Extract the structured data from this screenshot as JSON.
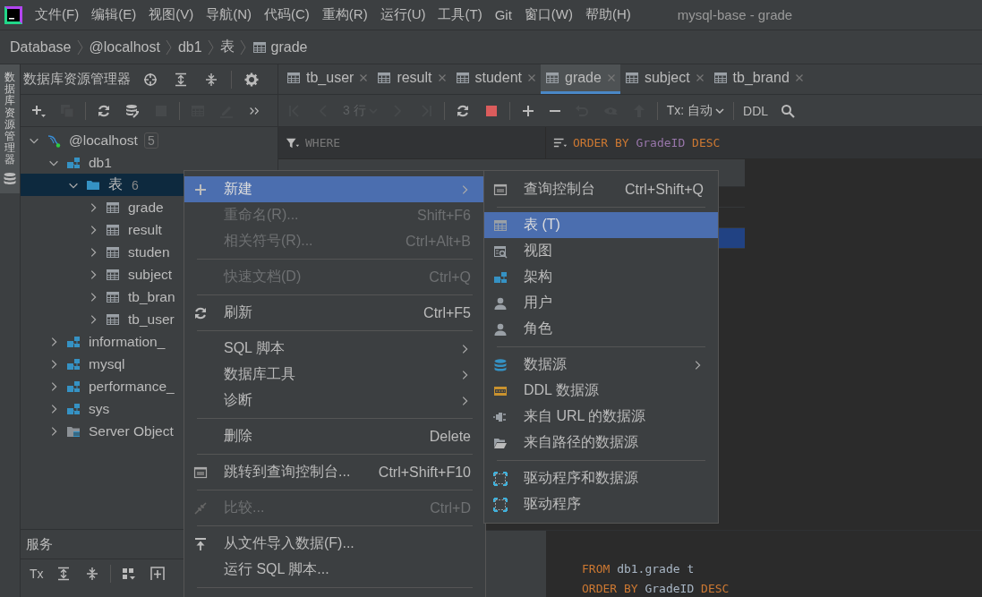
{
  "menu_bar": {
    "items": [
      "文件(F)",
      "编辑(E)",
      "视图(V)",
      "导航(N)",
      "代码(C)",
      "重构(R)",
      "运行(U)",
      "工具(T)",
      "Git",
      "窗口(W)",
      "帮助(H)"
    ],
    "title": "mysql-base - grade"
  },
  "breadcrumb": [
    {
      "label": "Database",
      "kind": "text"
    },
    {
      "label": "@localhost",
      "kind": "text"
    },
    {
      "label": "db1",
      "kind": "text"
    },
    {
      "label": "表",
      "kind": "text"
    },
    {
      "label": "grade",
      "kind": "table"
    }
  ],
  "side_stripe": {
    "label": "数据库资源管理器",
    "selected": true
  },
  "explorer": {
    "title": "数据库资源管理器",
    "toolbar": [
      {
        "kind": "add",
        "disabled": false
      },
      {
        "kind": "copy",
        "disabled": true
      },
      {
        "kind": "separator"
      },
      {
        "kind": "refresh",
        "disabled": false
      },
      {
        "kind": "db-settings",
        "disabled": false
      },
      {
        "kind": "stop",
        "disabled": true
      },
      {
        "kind": "separator"
      },
      {
        "kind": "table",
        "disabled": true
      },
      {
        "kind": "edit",
        "disabled": true
      },
      {
        "kind": "more",
        "disabled": false
      }
    ],
    "tree": [
      {
        "label": "@localhost",
        "count": "5",
        "kind": "host",
        "expanded": true,
        "selected": false,
        "children": [
          {
            "label": "db1",
            "kind": "schema",
            "expanded": true,
            "selected": false,
            "children": [
              {
                "label": "表",
                "count": "6",
                "kind": "folder",
                "expanded": true,
                "selected": true,
                "children": [
                  {
                    "label": "grade",
                    "kind": "table",
                    "expanded": false,
                    "selected": false
                  },
                  {
                    "label": "result",
                    "kind": "table",
                    "expanded": false,
                    "selected": false
                  },
                  {
                    "label": "studen",
                    "kind": "table",
                    "expanded": false,
                    "selected": false
                  },
                  {
                    "label": "subject",
                    "kind": "table",
                    "expanded": false,
                    "selected": false
                  },
                  {
                    "label": "tb_bran",
                    "kind": "table",
                    "expanded": false,
                    "selected": false
                  },
                  {
                    "label": "tb_user",
                    "kind": "table",
                    "expanded": false,
                    "selected": false
                  }
                ]
              }
            ]
          },
          {
            "label": "information_",
            "kind": "schema",
            "expanded": false,
            "selected": false
          },
          {
            "label": "mysql",
            "kind": "schema",
            "expanded": false,
            "selected": false
          },
          {
            "label": "performance_",
            "kind": "schema",
            "expanded": false,
            "selected": false
          },
          {
            "label": "sys",
            "kind": "schema",
            "expanded": false,
            "selected": false
          },
          {
            "label": "Server Object",
            "kind": "server",
            "expanded": false,
            "selected": false
          }
        ]
      }
    ]
  },
  "services": {
    "title": "服务",
    "toolbar": [
      {
        "kind": "tx",
        "label": "Tx"
      },
      {
        "kind": "expand"
      },
      {
        "kind": "collapse"
      },
      {
        "kind": "separator"
      },
      {
        "kind": "group"
      },
      {
        "kind": "add-frame"
      }
    ]
  },
  "editor_tabs": [
    {
      "label": "tb_user",
      "selected": false
    },
    {
      "label": "result",
      "selected": false
    },
    {
      "label": "student",
      "selected": false
    },
    {
      "label": "grade",
      "selected": true
    },
    {
      "label": "subject",
      "selected": false
    },
    {
      "label": "tb_brand",
      "selected": false
    }
  ],
  "editor_toolbar": [
    {
      "kind": "first",
      "disabled": true
    },
    {
      "kind": "previous",
      "disabled": true
    },
    {
      "kind": "rows",
      "label": "3 行",
      "disabled": true
    },
    {
      "kind": "next",
      "disabled": true
    },
    {
      "kind": "last",
      "disabled": true
    },
    {
      "kind": "separator"
    },
    {
      "kind": "refresh",
      "disabled": false
    },
    {
      "kind": "stop",
      "disabled": false
    },
    {
      "kind": "separator"
    },
    {
      "kind": "plus",
      "disabled": false
    },
    {
      "kind": "minus",
      "disabled": false
    },
    {
      "kind": "undo",
      "disabled": true
    },
    {
      "kind": "preview",
      "disabled": true
    },
    {
      "kind": "up",
      "disabled": true
    },
    {
      "kind": "separator"
    },
    {
      "kind": "tx",
      "label": "Tx: 自动",
      "disabled": false
    },
    {
      "kind": "separator"
    },
    {
      "kind": "ddl",
      "label": "DDL",
      "disabled": false
    },
    {
      "kind": "search",
      "disabled": false
    }
  ],
  "filter": {
    "where": {
      "placeholder": "WHERE"
    },
    "order": [
      {
        "text": "ORDER BY",
        "kind": "keyword"
      },
      {
        "text": "GradeID",
        "kind": "field"
      },
      {
        "text": "DESC",
        "kind": "keyword"
      }
    ]
  },
  "grid": {
    "rows": [
      {
        "selected": false
      },
      {
        "selected": false
      },
      {
        "selected": true
      }
    ]
  },
  "query": {
    "lines": [
      [
        {
          "text": "FROM",
          "kind": "keyword"
        },
        {
          "text": "db1.grade t",
          "kind": "plain"
        }
      ],
      [
        {
          "text": "ORDER BY",
          "kind": "keyword"
        },
        {
          "text": "GradeID",
          "kind": "plain"
        },
        {
          "text": "DESC",
          "kind": "keyword"
        }
      ]
    ]
  },
  "context_menu": {
    "items": [
      {
        "kind": "add",
        "label": "新建",
        "submenu": true,
        "disabled": false,
        "selected": true
      },
      {
        "kind": "plain",
        "label": "重命名(R)...",
        "shortcut": "Shift+F6",
        "submenu": false,
        "disabled": true,
        "selected": false
      },
      {
        "kind": "plain",
        "label": "相关符号(R)...",
        "shortcut": "Ctrl+Alt+B",
        "submenu": false,
        "disabled": true,
        "selected": false
      },
      {
        "kind": "separator"
      },
      {
        "kind": "plain",
        "label": "快速文档(D)",
        "shortcut": "Ctrl+Q",
        "submenu": false,
        "disabled": true,
        "selected": false
      },
      {
        "kind": "separator"
      },
      {
        "kind": "refresh",
        "label": "刷新",
        "shortcut": "Ctrl+F5",
        "submenu": false,
        "disabled": false,
        "selected": false
      },
      {
        "kind": "separator"
      },
      {
        "kind": "plain",
        "label": "SQL 脚本",
        "submenu": true,
        "disabled": false,
        "selected": false
      },
      {
        "kind": "plain",
        "label": "数据库工具",
        "submenu": true,
        "disabled": false,
        "selected": false
      },
      {
        "kind": "plain",
        "label": "诊断",
        "submenu": true,
        "disabled": false,
        "selected": false
      },
      {
        "kind": "separator"
      },
      {
        "kind": "plain",
        "label": "删除",
        "shortcut": "Delete",
        "submenu": false,
        "disabled": false,
        "selected": false
      },
      {
        "kind": "separator"
      },
      {
        "kind": "console",
        "label": "跳转到查询控制台...",
        "shortcut": "Ctrl+Shift+F10",
        "submenu": false,
        "disabled": false,
        "selected": false
      },
      {
        "kind": "separator"
      },
      {
        "kind": "compare",
        "label": "比较...",
        "shortcut": "Ctrl+D",
        "submenu": false,
        "disabled": true,
        "selected": false
      },
      {
        "kind": "separator"
      },
      {
        "kind": "import",
        "label": "从文件导入数据(F)...",
        "submenu": false,
        "disabled": false,
        "selected": false
      },
      {
        "kind": "plain",
        "label": "运行 SQL 脚本...",
        "submenu": false,
        "disabled": false,
        "selected": false
      },
      {
        "kind": "separator"
      }
    ]
  },
  "submenu": {
    "items": [
      {
        "kind": "console",
        "label": "查询控制台",
        "shortcut": "Ctrl+Shift+Q",
        "submenu": false,
        "selected": false
      },
      {
        "kind": "separator"
      },
      {
        "kind": "table",
        "label": "表 (T)",
        "submenu": false,
        "selected": true
      },
      {
        "kind": "view",
        "label": "视图",
        "submenu": false,
        "selected": false
      },
      {
        "kind": "schema",
        "label": "架构",
        "submenu": false,
        "selected": false
      },
      {
        "kind": "user",
        "label": "用户",
        "submenu": false,
        "selected": false
      },
      {
        "kind": "user",
        "label": "角色",
        "submenu": false,
        "selected": false
      },
      {
        "kind": "separator"
      },
      {
        "kind": "database",
        "label": "数据源",
        "submenu": true,
        "selected": false
      },
      {
        "kind": "ddl",
        "label": "DDL 数据源",
        "submenu": false,
        "selected": false
      },
      {
        "kind": "plug",
        "label": "来自 URL 的数据源",
        "submenu": false,
        "selected": false
      },
      {
        "kind": "folder",
        "label": "来自路径的数据源",
        "submenu": false,
        "selected": false
      },
      {
        "kind": "separator"
      },
      {
        "kind": "driver",
        "label": "驱动程序和数据源",
        "submenu": false,
        "selected": false
      },
      {
        "kind": "driver",
        "label": "驱动程序",
        "submenu": false,
        "selected": false
      }
    ]
  }
}
